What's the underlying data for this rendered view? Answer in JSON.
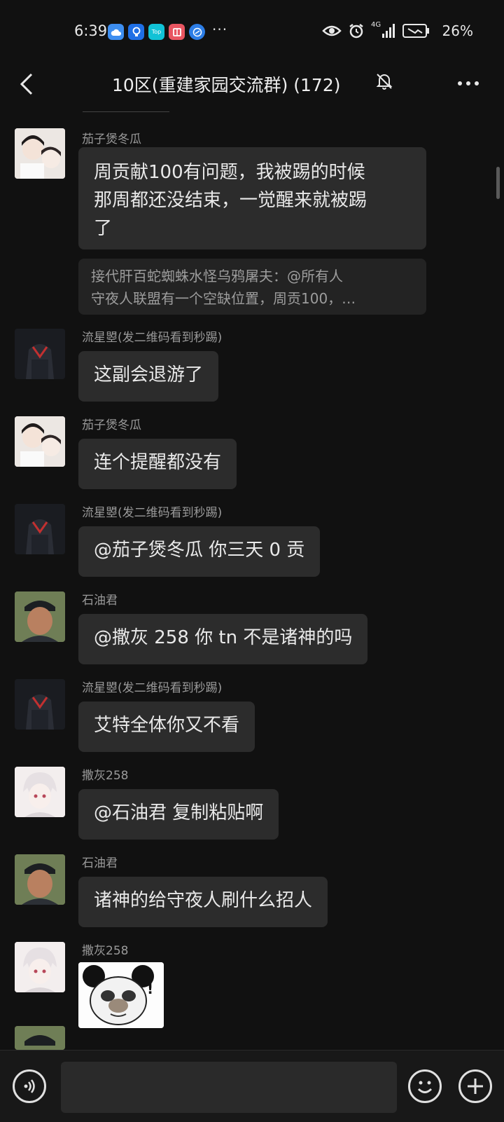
{
  "status_bar": {
    "time": "6:39",
    "app_icons": [
      "cloud-icon",
      "bulb-icon",
      "top-icon",
      "book-icon",
      "browser-icon"
    ],
    "top_icon_label": "Top",
    "more": "···",
    "network": "4G",
    "battery_percent": "26%"
  },
  "header": {
    "title": "10区(重建家园交流群) (172)",
    "muted": true
  },
  "messages": [
    {
      "sender": "茄子煲冬瓜",
      "lines": [
        "周贡献100有问题，我被踢的时候",
        "那周都还没结束，一觉醒来就被踢",
        "了"
      ],
      "quote_lines": [
        "接代肝百蛇蜘蛛水怪乌鸦屠夫：@所有人",
        "守夜人联盟有一个空缺位置，周贡100，…"
      ],
      "avatar": "eggplant"
    },
    {
      "sender": "流星曌(发二维码看到秒踢)",
      "text": "这副会退游了",
      "avatar": "meteor"
    },
    {
      "sender": "茄子煲冬瓜",
      "text": "连个提醒都没有",
      "avatar": "eggplant"
    },
    {
      "sender": "流星曌(发二维码看到秒踢)",
      "text": "@茄子煲冬瓜  你三天 0 贡",
      "avatar": "meteor"
    },
    {
      "sender": "石油君",
      "text": "@撒灰 258 你 tn 不是诸神的吗",
      "avatar": "oil"
    },
    {
      "sender": "流星曌(发二维码看到秒踢)",
      "text": "艾特全体你又不看",
      "avatar": "meteor"
    },
    {
      "sender": "撒灰258",
      "text": "@石油君  复制粘贴啊",
      "avatar": "ash"
    },
    {
      "sender": "石油君",
      "text": "诸神的给守夜人刷什么招人",
      "avatar": "oil"
    },
    {
      "sender": "撒灰258",
      "sticker": "panda-meme-sticker",
      "sticker_text": "!",
      "avatar": "ash"
    }
  ],
  "input": {
    "placeholder": ""
  }
}
